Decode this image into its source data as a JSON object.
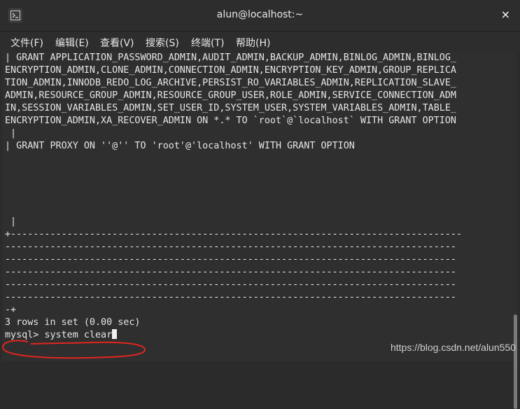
{
  "window": {
    "title": "alun@localhost:~",
    "close_glyph": "×"
  },
  "menu": [
    "文件(F)",
    "编辑(E)",
    "查看(V)",
    "搜索(S)",
    "终端(T)",
    "帮助(H)"
  ],
  "terminal": {
    "lines": [
      "| GRANT APPLICATION_PASSWORD_ADMIN,AUDIT_ADMIN,BACKUP_ADMIN,BINLOG_ADMIN,BINLOG_",
      "ENCRYPTION_ADMIN,CLONE_ADMIN,CONNECTION_ADMIN,ENCRYPTION_KEY_ADMIN,GROUP_REPLICA",
      "TION_ADMIN,INNODB_REDO_LOG_ARCHIVE,PERSIST_RO_VARIABLES_ADMIN,REPLICATION_SLAVE_",
      "ADMIN,RESOURCE_GROUP_ADMIN,RESOURCE_GROUP_USER,ROLE_ADMIN,SERVICE_CONNECTION_ADM",
      "IN,SESSION_VARIABLES_ADMIN,SET_USER_ID,SYSTEM_USER,SYSTEM_VARIABLES_ADMIN,TABLE_",
      "ENCRYPTION_ADMIN,XA_RECOVER_ADMIN ON *.* TO `root`@`localhost` WITH GRANT OPTION",
      " |",
      "| GRANT PROXY ON ''@'' TO 'root'@'localhost' WITH GRANT OPTION",
      "",
      "",
      "",
      "",
      "",
      " |",
      "+--------------------------------------------------------------------------------",
      "--------------------------------------------------------------------------------",
      "--------------------------------------------------------------------------------",
      "--------------------------------------------------------------------------------",
      "--------------------------------------------------------------------------------",
      "--------------------------------------------------------------------------------",
      "-+",
      "3 rows in set (0.00 sec)",
      ""
    ],
    "prompt": "mysql> ",
    "command": "system clear"
  },
  "watermark": "https://blog.csdn.net/alun550",
  "colors": {
    "background": "#2f2f2f",
    "text": "#e6e6e6",
    "annotation": "#e0261f"
  }
}
